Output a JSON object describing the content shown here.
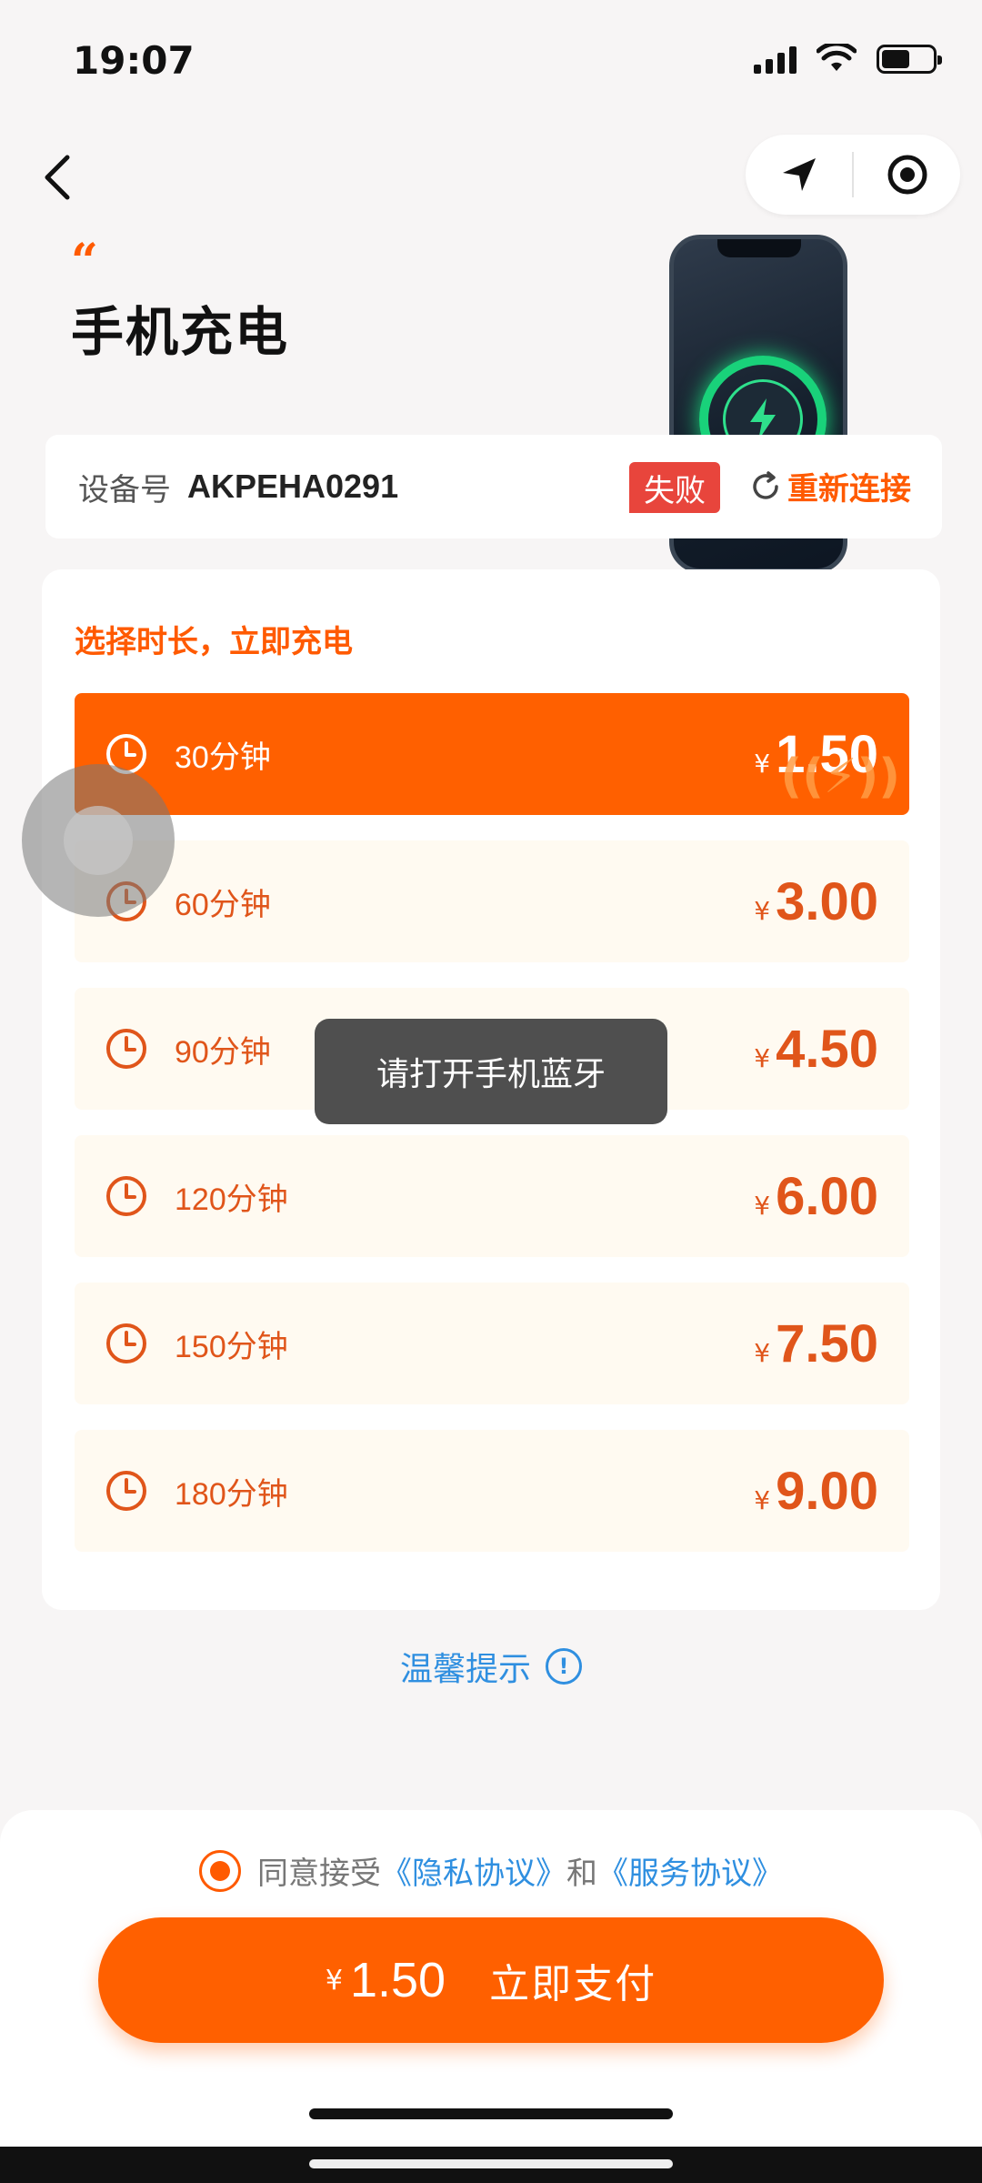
{
  "status_bar": {
    "time": "19:07"
  },
  "header": {
    "title": "手机充电"
  },
  "device": {
    "label": "设备号",
    "id": "AKPEHA0291",
    "status": "失败",
    "reconnect_label": "重新连接"
  },
  "options": {
    "title": "选择时长，立即充电",
    "currency": "¥",
    "items": [
      {
        "minutes": "30分钟",
        "price": "1.50",
        "selected": true
      },
      {
        "minutes": "60分钟",
        "price": "3.00",
        "selected": false
      },
      {
        "minutes": "90分钟",
        "price": "4.50",
        "selected": false
      },
      {
        "minutes": "120分钟",
        "price": "6.00",
        "selected": false
      },
      {
        "minutes": "150分钟",
        "price": "7.50",
        "selected": false
      },
      {
        "minutes": "180分钟",
        "price": "9.00",
        "selected": false
      }
    ]
  },
  "toast": {
    "message": "请打开手机蓝牙"
  },
  "tips": {
    "label": "温馨提示"
  },
  "agreement": {
    "prefix": "同意接受",
    "privacy": "《隐私协议》",
    "and": "和",
    "service": "《服务协议》",
    "checked": true
  },
  "pay": {
    "currency": "¥",
    "amount": "1.50",
    "label": "立即支付"
  },
  "colors": {
    "accent": "#ff6000",
    "link": "#2f8fe0",
    "fail": "#e8453c",
    "option_bg": "#fffaf1"
  },
  "icons": [
    "back-icon",
    "location-arrow-icon",
    "record-icon",
    "clock-icon",
    "refresh-icon",
    "info-icon",
    "charging-bolt-icon"
  ]
}
